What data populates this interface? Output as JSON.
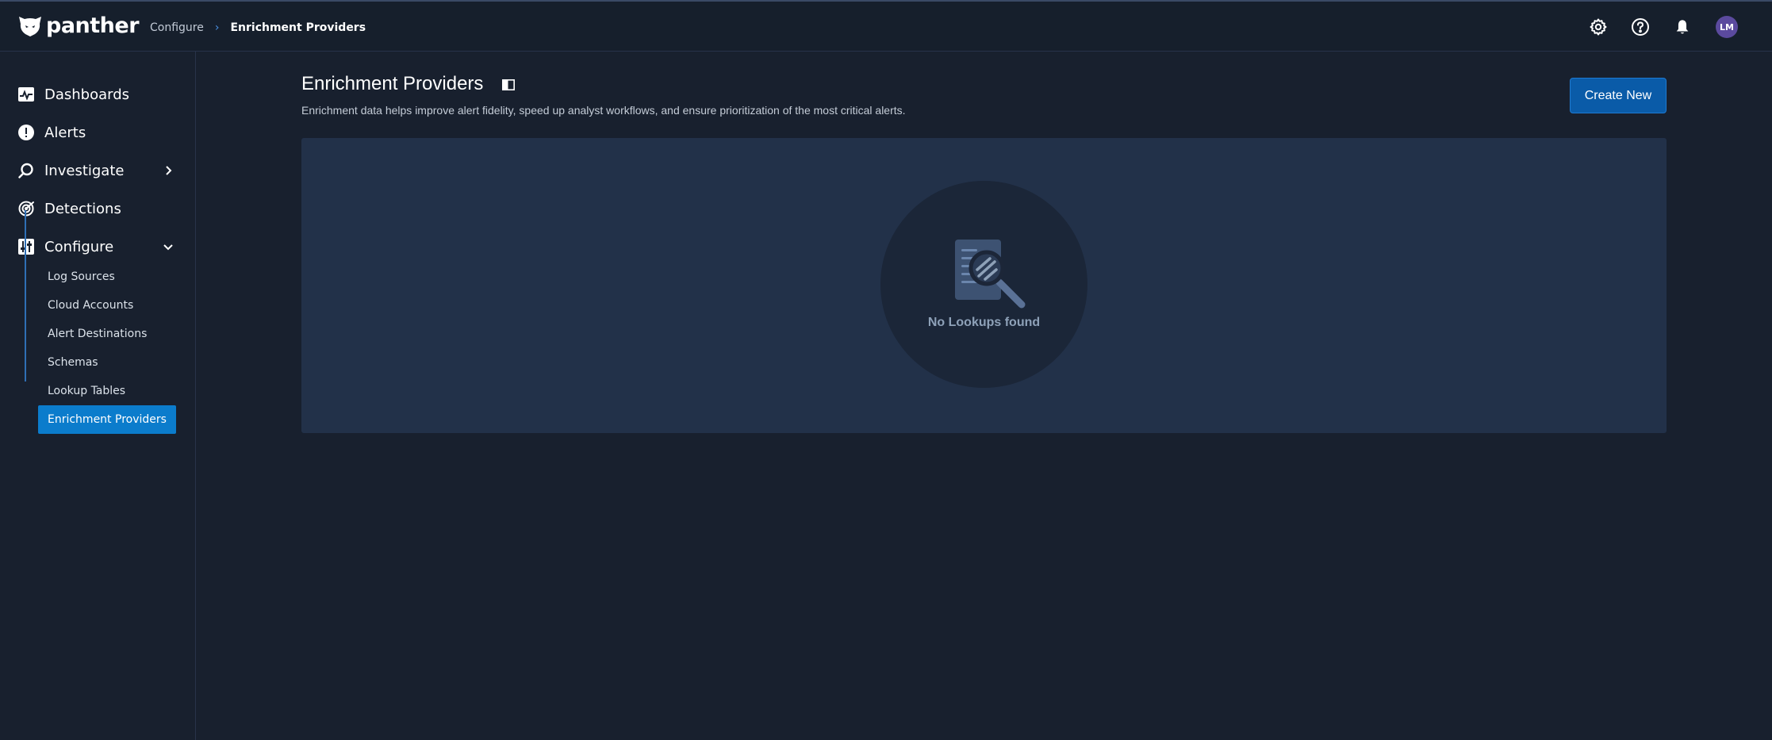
{
  "topbar": {
    "logo_text": "panther",
    "breadcrumb": {
      "parent": "Configure",
      "separator": "›",
      "current": "Enrichment Providers"
    },
    "icons": [
      "gear-icon",
      "help-icon",
      "bell-icon"
    ],
    "avatar_initials": "LM"
  },
  "sidebar": {
    "items": [
      {
        "label": "Dashboards",
        "icon": "dashboard-icon"
      },
      {
        "label": "Alerts",
        "icon": "alert-icon"
      },
      {
        "label": "Investigate",
        "icon": "search-icon"
      },
      {
        "label": "Detections",
        "icon": "detections-icon"
      },
      {
        "label": "Configure",
        "icon": "configure-icon"
      }
    ],
    "configure_subitems": [
      {
        "label": "Log Sources"
      },
      {
        "label": "Cloud Accounts"
      },
      {
        "label": "Alert Destinations"
      },
      {
        "label": "Schemas"
      },
      {
        "label": "Lookup Tables"
      },
      {
        "label": "Enrichment Providers",
        "active": true
      }
    ]
  },
  "main": {
    "title": "Enrichment Providers",
    "description": "Enrichment data helps improve alert fidelity, speed up analyst workflows, and ensure prioritization of the most critical alerts.",
    "create_button_label": "Create New",
    "empty_state_text": "No Lookups found"
  },
  "colors": {
    "accent": "#0b7ccc",
    "button": "#0a5ba8",
    "background": "#18202e",
    "panel": "#223149"
  }
}
